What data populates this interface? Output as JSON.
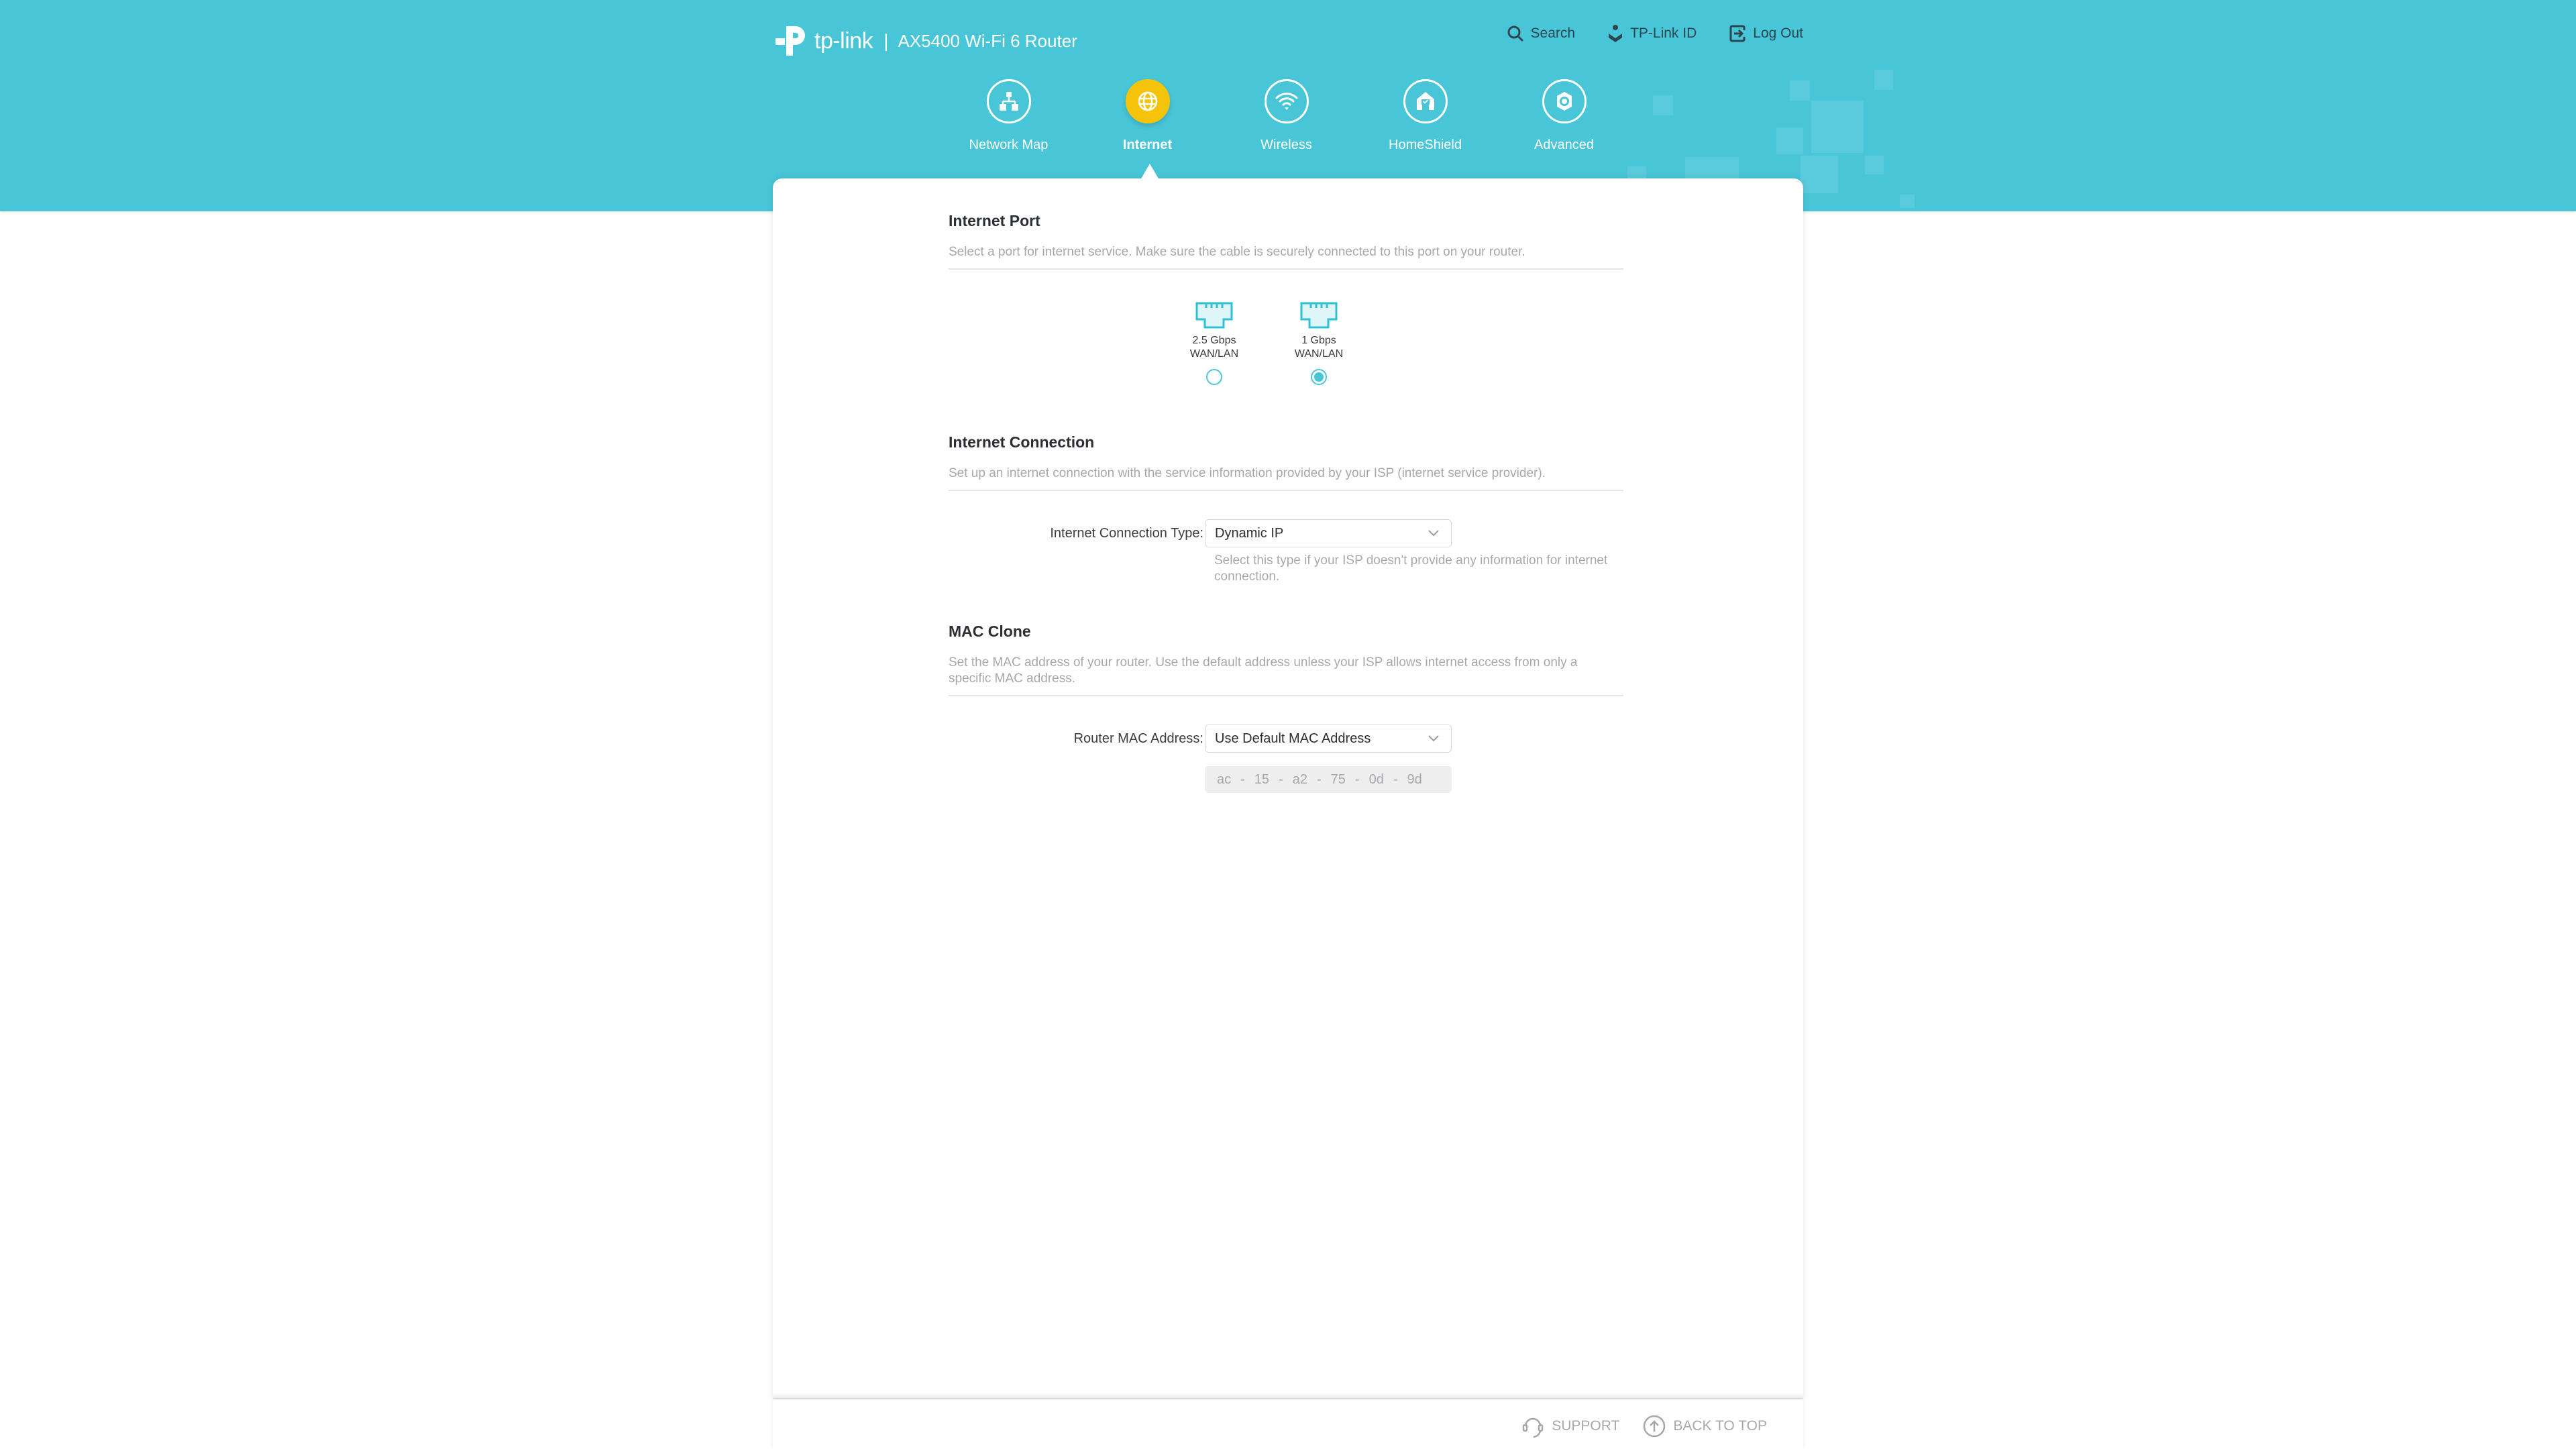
{
  "header": {
    "brand": "tp-link",
    "separator": "|",
    "model": "AX5400 Wi-Fi 6 Router",
    "actions": [
      {
        "id": "search",
        "label": "Search",
        "icon": "search-icon"
      },
      {
        "id": "tplink-id",
        "label": "TP-Link ID",
        "icon": "tplink-id-icon"
      },
      {
        "id": "logout",
        "label": "Log Out",
        "icon": "logout-icon"
      }
    ]
  },
  "nav": {
    "active": "Internet",
    "items": [
      {
        "label": "Network Map",
        "icon": "network-map-icon"
      },
      {
        "label": "Internet",
        "icon": "globe-icon"
      },
      {
        "label": "Wireless",
        "icon": "wifi-icon"
      },
      {
        "label": "HomeShield",
        "icon": "homeshield-icon"
      },
      {
        "label": "Advanced",
        "icon": "gear-icon"
      }
    ]
  },
  "internet_port": {
    "title": "Internet Port",
    "description": "Select a port for internet service. Make sure the cable is securely connected to this port on your router.",
    "ports": [
      {
        "line1": "2.5 Gbps",
        "line2": "WAN/LAN",
        "selected": false
      },
      {
        "line1": "1 Gbps",
        "line2": "WAN/LAN",
        "selected": true
      }
    ]
  },
  "internet_connection": {
    "title": "Internet Connection",
    "description": "Set up an internet connection with the service information provided by your ISP (internet service provider).",
    "type_label": "Internet Connection Type:",
    "type_value": "Dynamic IP",
    "type_hint": "Select this type if your ISP doesn't provide any information for internet connection."
  },
  "mac_clone": {
    "title": "MAC Clone",
    "description": "Set the MAC address of your router. Use the default address unless your ISP allows internet access from only a specific MAC address.",
    "mac_label": "Router MAC Address:",
    "mac_select_value": "Use Default MAC Address",
    "mac_octets": [
      "ac",
      "15",
      "a2",
      "75",
      "0d",
      "9d"
    ],
    "mac_separator": "-"
  },
  "footer": {
    "support_label": "SUPPORT",
    "back_to_top_label": "BACK TO TOP"
  },
  "colors": {
    "brand_teal": "#48c6d8",
    "active_nav": "#f5c40a",
    "muted_text": "#a6a8ab"
  }
}
